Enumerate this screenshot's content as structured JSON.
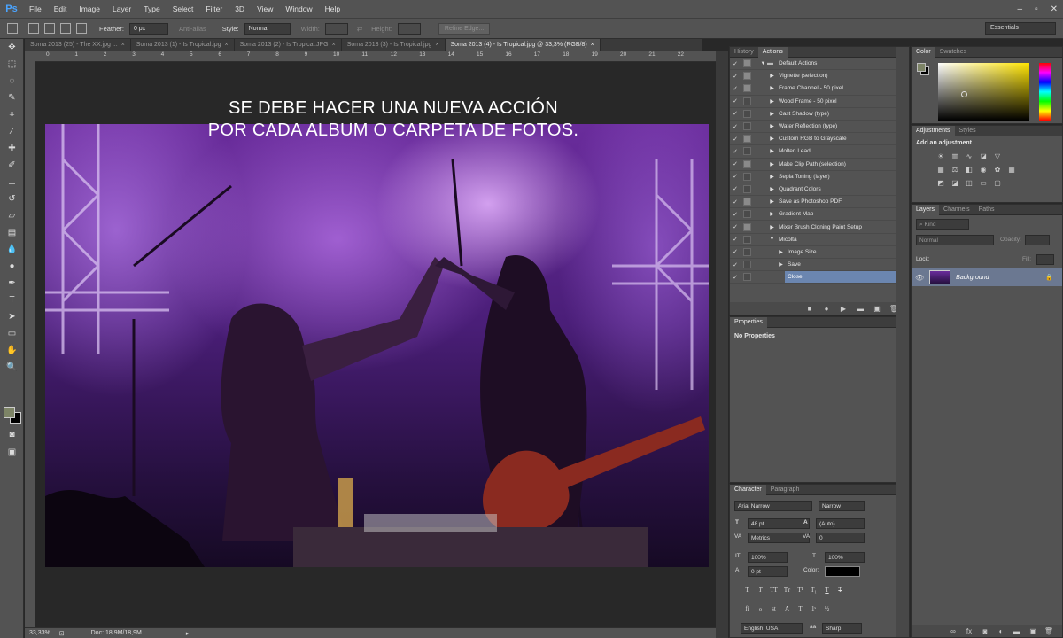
{
  "menubar": {
    "logo": "Ps",
    "items": [
      "File",
      "Edit",
      "Image",
      "Layer",
      "Type",
      "Select",
      "Filter",
      "3D",
      "View",
      "Window",
      "Help"
    ]
  },
  "options": {
    "feather_label": "Feather:",
    "feather_value": "0 px",
    "antialias_label": "Anti-alias",
    "style_label": "Style:",
    "style_value": "Normal",
    "width_label": "Width:",
    "height_label": "Height:",
    "refine_label": "Refine Edge...",
    "workspace": "Essentials"
  },
  "tabs": [
    {
      "label": "Soma 2013 (25) - The XX.jpg ...",
      "active": false
    },
    {
      "label": "Soma 2013 (1) - Is Tropical.jpg",
      "active": false
    },
    {
      "label": "Soma 2013 (2) - Is Tropical.JPG",
      "active": false
    },
    {
      "label": "Soma 2013 (3) - Is Tropical.jpg",
      "active": false
    },
    {
      "label": "Soma 2013 (4) - Is Tropical.jpg @ 33,3% (RGB/8)",
      "active": true
    }
  ],
  "ruler_ticks": [
    "0",
    "1",
    "2",
    "3",
    "4",
    "5",
    "6",
    "7",
    "8",
    "9",
    "10",
    "11",
    "12",
    "13",
    "14",
    "15",
    "16",
    "17",
    "18",
    "19",
    "20",
    "21",
    "22"
  ],
  "caption": {
    "line1": "SE DEBE HACER UNA NUEVA ACCIÓN",
    "line2": "POR CADA ALBUM O CARPETA DE FOTOS."
  },
  "status": {
    "zoom": "33,33%",
    "doc": "Doc: 18,9M/18,9M"
  },
  "actions_panel": {
    "tabs": [
      "History",
      "Actions"
    ],
    "rows": [
      {
        "label": "Default Actions",
        "level": 0,
        "open": true,
        "folder": true,
        "dialog": true
      },
      {
        "label": "Vignette (selection)",
        "level": 1,
        "dialog": true
      },
      {
        "label": "Frame Channel - 50 pixel",
        "level": 1,
        "dialog": true
      },
      {
        "label": "Wood Frame - 50 pixel",
        "level": 1,
        "dialog": false
      },
      {
        "label": "Cast Shadow (type)",
        "level": 1,
        "dialog": false
      },
      {
        "label": "Water Reflection (type)",
        "level": 1,
        "dialog": false
      },
      {
        "label": "Custom RGB to Grayscale",
        "level": 1,
        "dialog": true
      },
      {
        "label": "Molten Lead",
        "level": 1,
        "dialog": false
      },
      {
        "label": "Make Clip Path (selection)",
        "level": 1,
        "dialog": true
      },
      {
        "label": "Sepia Toning (layer)",
        "level": 1,
        "dialog": false
      },
      {
        "label": "Quadrant Colors",
        "level": 1,
        "dialog": false
      },
      {
        "label": "Save as Photoshop PDF",
        "level": 1,
        "dialog": true
      },
      {
        "label": "Gradient Map",
        "level": 1,
        "dialog": false
      },
      {
        "label": "Mixer Brush Cloning Paint Setup",
        "level": 1,
        "dialog": true
      },
      {
        "label": "Micolta",
        "level": 1,
        "open": true,
        "dialog": false
      },
      {
        "label": "Image Size",
        "level": 2,
        "dialog": false
      },
      {
        "label": "Save",
        "level": 2,
        "dialog": false
      },
      {
        "label": "Close",
        "level": 2,
        "dialog": false,
        "selected": true
      }
    ]
  },
  "properties": {
    "tab": "Properties",
    "text": "No Properties"
  },
  "character": {
    "tabs": [
      "Character",
      "Paragraph"
    ],
    "font": "Arial Narrow",
    "style": "Narrow",
    "size": "48 pt",
    "leading": "(Auto)",
    "kerning": "Metrics",
    "tracking": "0",
    "vscale": "100%",
    "hscale": "100%",
    "baseline": "0 pt",
    "color_label": "Color:",
    "lang": "English: USA",
    "aa": "Sharp",
    "color": "#000000"
  },
  "color_panel": {
    "tabs": [
      "Color",
      "Swatches"
    ],
    "fg": "#7d8466"
  },
  "adjustments": {
    "tabs": [
      "Adjustments",
      "Styles"
    ],
    "title": "Add an adjustment"
  },
  "layers": {
    "tabs": [
      "Layers",
      "Channels",
      "Paths"
    ],
    "kind": "Kind",
    "mode": "Normal",
    "opacity_label": "Opacity:",
    "lock_label": "Lock:",
    "fill_label": "Fill:",
    "layer_name": "Background"
  }
}
